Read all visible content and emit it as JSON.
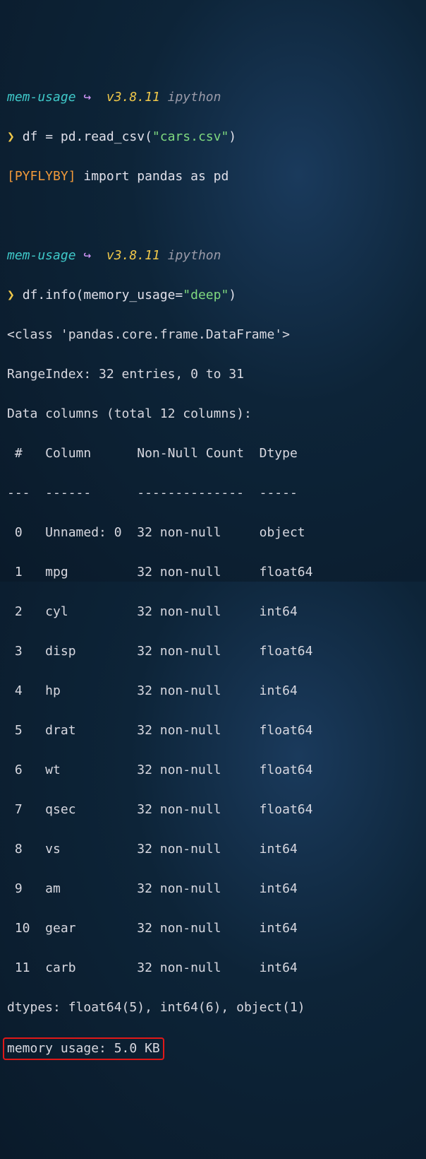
{
  "prompt1": {
    "env": "mem-usage",
    "arrow": "↪",
    "version": "v3.8.11",
    "interp": "ipython",
    "marker": "❯",
    "cmd_pre": "df = pd.read_csv(",
    "cmd_str": "\"cars.csv\"",
    "cmd_post": ")"
  },
  "pyflyby": {
    "tag": "[PYFLYBY]",
    "msg": " import pandas as pd"
  },
  "prompt2": {
    "env": "mem-usage",
    "arrow": "↪",
    "version": "v3.8.11",
    "interp": "ipython",
    "marker": "❯",
    "cmd_pre": "df.info(memory_usage=",
    "cmd_str": "\"deep\"",
    "cmd_post": ")"
  },
  "output": {
    "class_line": "<class 'pandas.core.frame.DataFrame'>",
    "range_line": "RangeIndex: 32 entries, 0 to 31",
    "cols_line": "Data columns (total 12 columns):",
    "header": " #   Column      Non-Null Count  Dtype  ",
    "divider": "---  ------      --------------  -----  ",
    "rows": [
      " 0   Unnamed: 0  32 non-null     object ",
      " 1   mpg         32 non-null     float64",
      " 2   cyl         32 non-null     int64  ",
      " 3   disp        32 non-null     float64",
      " 4   hp          32 non-null     int64  ",
      " 5   drat        32 non-null     float64",
      " 6   wt          32 non-null     float64",
      " 7   qsec        32 non-null     float64",
      " 8   vs          32 non-null     int64  ",
      " 9   am          32 non-null     int64  ",
      " 10  gear        32 non-null     int64  ",
      " 11  carb        32 non-null     int64  "
    ],
    "dtypes_line": "dtypes: float64(5), int64(6), object(1)",
    "memory_line": "memory usage: 5.0 KB"
  }
}
